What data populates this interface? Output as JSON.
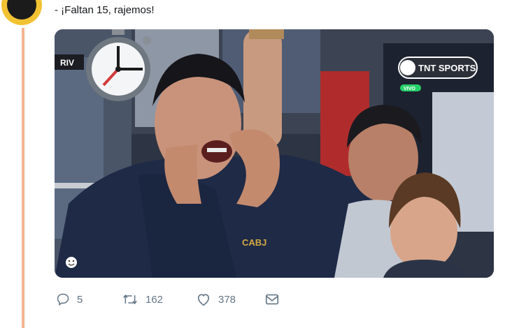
{
  "tweet": {
    "text": "- ¡Faltan 15, rajemos!"
  },
  "media": {
    "scoreboard_team": "RIV",
    "broadcaster": "TNT SPORTS",
    "live_label": "VIVO",
    "jacket_text": "CABJ"
  },
  "actions": {
    "reply_count": "5",
    "retweet_count": "162",
    "like_count": "378"
  },
  "colors": {
    "thread_line": "#f5b48e",
    "avatar_ring": "#f1c232",
    "action_gray": "#657786",
    "live_green": "#27d16a"
  },
  "icons": [
    "reply-icon",
    "retweet-icon",
    "like-icon",
    "message-icon",
    "stopwatch-icon",
    "emoji-icon"
  ]
}
